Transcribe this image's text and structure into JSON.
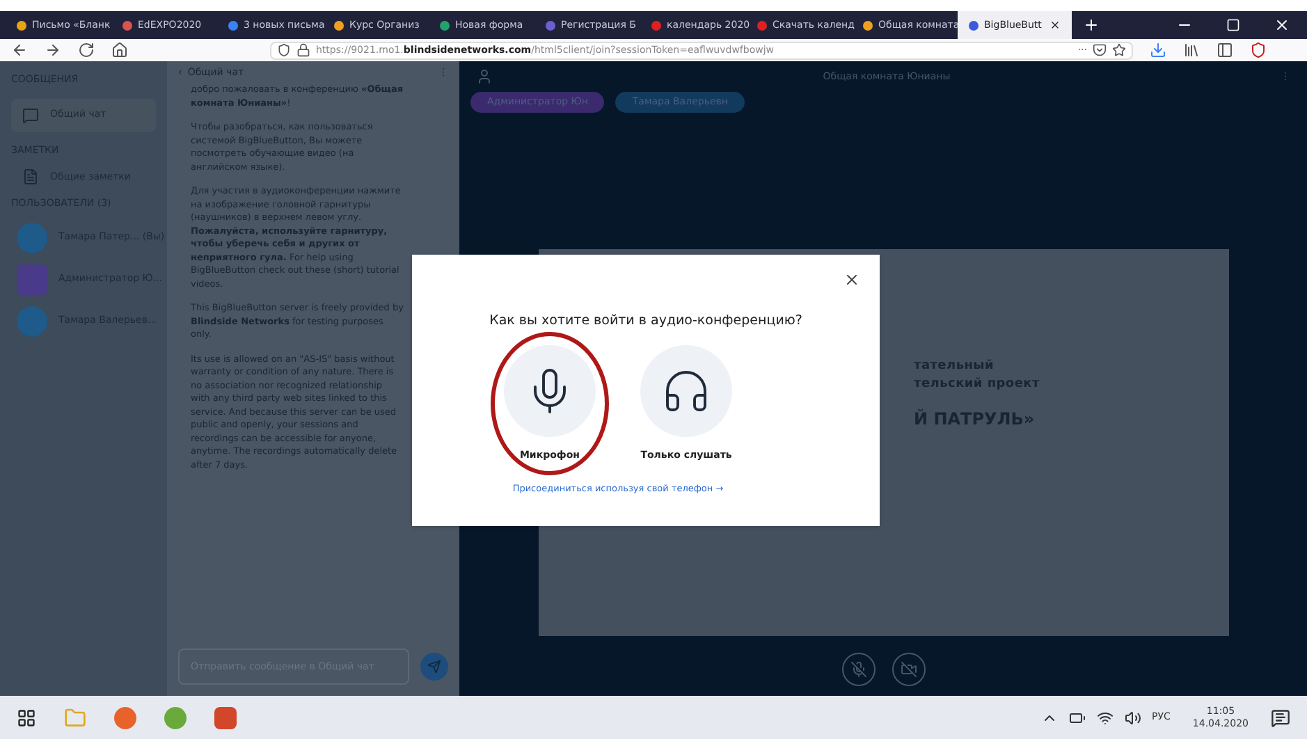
{
  "browser": {
    "tabs": [
      {
        "label": "Письмо «Бланк",
        "selected": false,
        "color": "#e8a317"
      },
      {
        "label": "EdEXPO2020",
        "selected": false,
        "color": "#d9534f"
      },
      {
        "label": "3 новых письма",
        "selected": false,
        "color": "#3b82f6"
      },
      {
        "label": "Курс Организ",
        "selected": false,
        "color": "#f0a020"
      },
      {
        "label": "Новая форма",
        "selected": false,
        "color": "#22a36b"
      },
      {
        "label": "Регистрация Б",
        "selected": false,
        "color": "#6d5fd3"
      },
      {
        "label": "календарь 2020",
        "selected": false,
        "color": "#e02020"
      },
      {
        "label": "Скачать календ",
        "selected": false,
        "color": "#e02020"
      },
      {
        "label": "Общая комната",
        "selected": false,
        "color": "#f0a020"
      },
      {
        "label": "BigBlueButt",
        "selected": true,
        "color": "#3b5bdb"
      }
    ],
    "url": {
      "prefix": "https://9021.mo1.",
      "domain": "blindsidenetworks.com",
      "path": "/html5client/join?sessionToken=eaflwuvdwfbowjw"
    },
    "more": "···"
  },
  "sidebar": {
    "messages_heading": "СООБЩЕНИЯ",
    "chat_item": "Общий чат",
    "notes_heading": "ЗАМЕТКИ",
    "notes_item": "Общие заметки",
    "users_heading": "ПОЛЬЗОВАТЕЛИ (3)",
    "users": [
      {
        "name": "Тамара Патер... (Вы)",
        "kind": "circle",
        "color": "#1e5a8a"
      },
      {
        "name": "Администратор Ю...",
        "kind": "square",
        "color": "#4a3a8a"
      },
      {
        "name": "Тамара Валерьев...",
        "kind": "circle",
        "color": "#1e5a8a"
      }
    ]
  },
  "chat": {
    "back": "‹",
    "title": "Общий чат",
    "kebab": "⋮",
    "messages": [
      "добро пожаловать в конференцию **«Общая комната Юнианы»**!",
      "Чтобы разобраться, как пользоваться системой BigBlueButton, Вы можете посмотреть обучающие видео (на английском языке).",
      "Для участия в аудиоконференции нажмите на изображение головной гарнитуры (наушников) в верхнем левом углу. **Пожалуйста, используйте гарнитуру, чтобы уберечь себя и других от неприятного гула.** For help using BigBlueButton check out these (short) tutorial videos.",
      "This BigBlueButton server is freely provided by **Blindside Networks** for testing purposes only.",
      "Its use is allowed on an \"AS-IS\" basis without warranty or condition of any nature. There is no association nor recognized relationship with any third party web sites linked to this service. And because this server can be used public and openly, your sessions and recordings can be accessible for anyone, anytime. The recordings automatically delete after 7 days."
    ],
    "placeholder": "Отправить сообщение в Общий чат"
  },
  "main": {
    "title": "Общая комната Юнианы",
    "kebab": "⋮",
    "talkers": [
      {
        "name": "Администратор Юн",
        "color": "#3b2a6e"
      },
      {
        "name": "Тамара Валерьевн",
        "color": "#123a5c"
      }
    ],
    "slide_lines": [
      {
        "text": "тательный",
        "kind": "subtitle"
      },
      {
        "text": "тельский проект",
        "kind": "subtitle"
      },
      {
        "text": "Й ПАТРУЛЬ»",
        "kind": "title"
      }
    ]
  },
  "dialog": {
    "title": "Как вы хотите войти в аудио-конференцию?",
    "options": [
      {
        "label": "Микрофон",
        "kind": "microphone",
        "circled": true
      },
      {
        "label": "Только слушать",
        "kind": "headphones",
        "circled": false
      }
    ],
    "phone_link": "Присоединиться используя свой телефон →"
  },
  "taskbar": {
    "language": "РУС",
    "time": "11:05",
    "date": "14.04.2020"
  }
}
